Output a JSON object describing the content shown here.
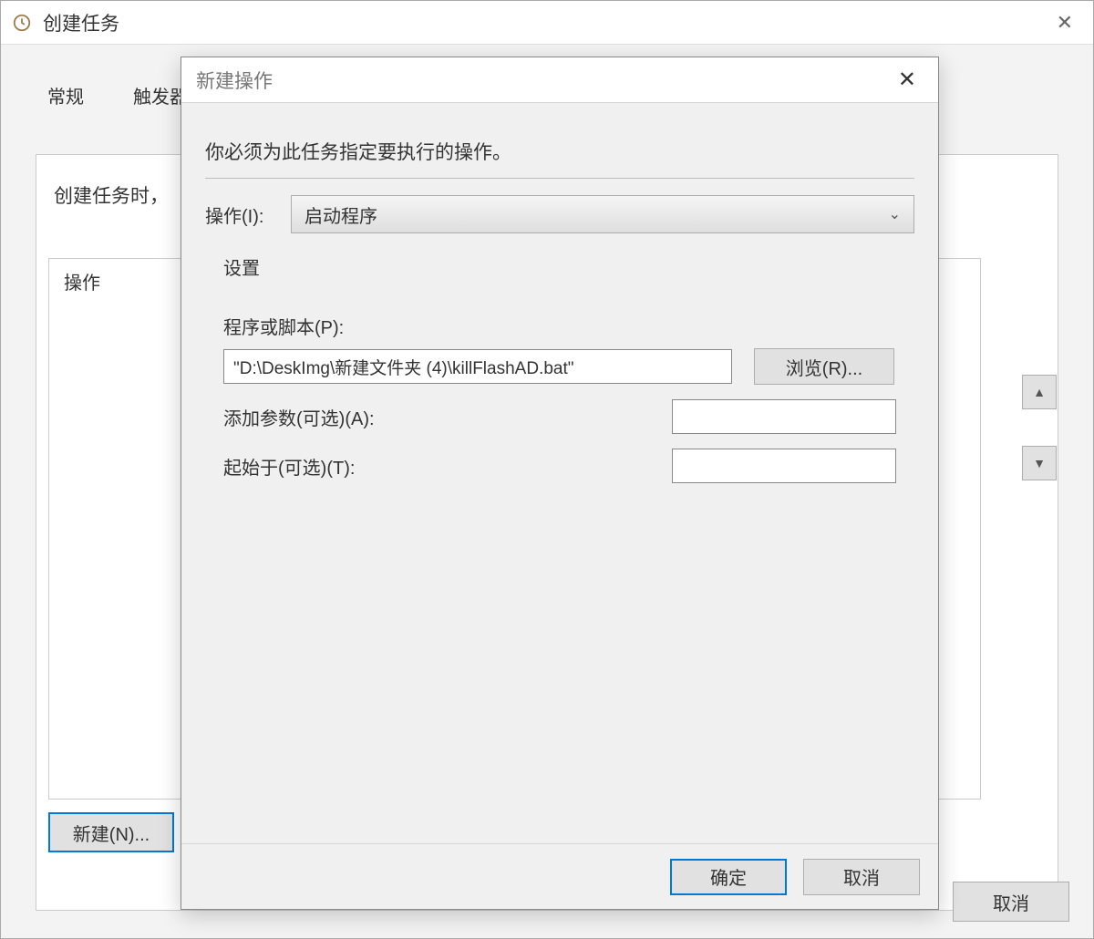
{
  "parent_window": {
    "title": "创建任务",
    "tabs": [
      "常规",
      "触发器"
    ],
    "intro_text": "创建任务时，",
    "list_header": "操作",
    "new_button": "新建(N)...",
    "cancel_button": "取消",
    "up_arrow": "▲",
    "down_arrow": "▼"
  },
  "child_window": {
    "title": "新建操作",
    "instruction": "你必须为此任务指定要执行的操作。",
    "action_label": "操作(I):",
    "action_value": "启动程序",
    "settings_label": "设置",
    "program_label": "程序或脚本(P):",
    "program_value": "\"D:\\DeskImg\\新建文件夹 (4)\\killFlashAD.bat\"",
    "browse_button": "浏览(R)...",
    "args_label": "添加参数(可选)(A):",
    "args_value": "",
    "startin_label": "起始于(可选)(T):",
    "startin_value": "",
    "ok_button": "确定",
    "cancel_button": "取消"
  }
}
